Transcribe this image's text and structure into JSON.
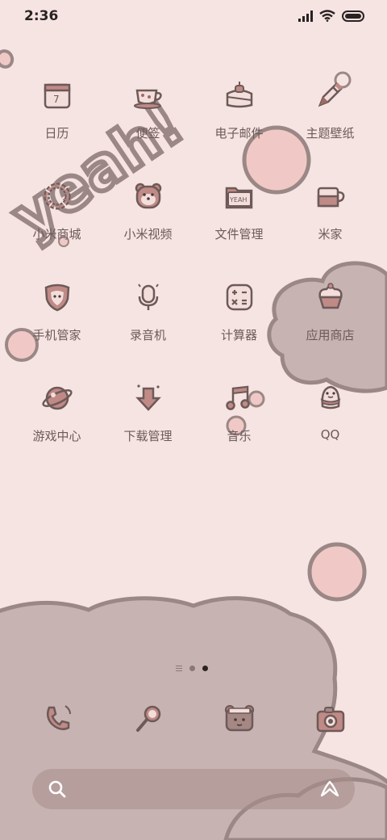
{
  "status_bar": {
    "time": "2:36",
    "icons": [
      "signal-icon",
      "wifi-icon",
      "battery-icon"
    ]
  },
  "wallpaper": {
    "doodle_text": "yeah!",
    "colors": {
      "background": "#f5e4e2",
      "cloud": "#c7b3b1",
      "cloud_border": "#9b8886",
      "circle": "#f0c9c6"
    }
  },
  "apps": [
    {
      "label": "日历",
      "icon": "calendar-icon",
      "badge": "7"
    },
    {
      "label": "便签",
      "icon": "notes-teacup-icon"
    },
    {
      "label": "电子邮件",
      "icon": "email-icon"
    },
    {
      "label": "主题壁纸",
      "icon": "theme-pencil-icon"
    },
    {
      "label": "小米商城",
      "icon": "mall-bracelet-icon"
    },
    {
      "label": "小米视频",
      "icon": "video-bear-icon"
    },
    {
      "label": "文件管理",
      "icon": "file-manager-icon",
      "badge": "YEAH"
    },
    {
      "label": "米家",
      "icon": "mijia-cup-icon"
    },
    {
      "label": "手机管家",
      "icon": "security-shield-icon"
    },
    {
      "label": "录音机",
      "icon": "recorder-mic-icon"
    },
    {
      "label": "计算器",
      "icon": "calculator-icon"
    },
    {
      "label": "应用商店",
      "icon": "app-store-cupcake-icon"
    },
    {
      "label": "游戏中心",
      "icon": "game-planet-icon"
    },
    {
      "label": "下载管理",
      "icon": "download-arrow-icon"
    },
    {
      "label": "音乐",
      "icon": "music-note-icon"
    },
    {
      "label": "QQ",
      "icon": "qq-penguin-icon"
    }
  ],
  "pager": {
    "pages": 2,
    "active": 2,
    "has_feed_page": true
  },
  "dock": [
    {
      "name": "phone",
      "icon": "phone-icon"
    },
    {
      "name": "browser",
      "icon": "magnifier-icon"
    },
    {
      "name": "gallery",
      "icon": "bear-frame-icon"
    },
    {
      "name": "camera",
      "icon": "camera-icon"
    }
  ],
  "search_bar": {
    "left_icon": "search-icon",
    "right_icon": "assistant-icon"
  }
}
